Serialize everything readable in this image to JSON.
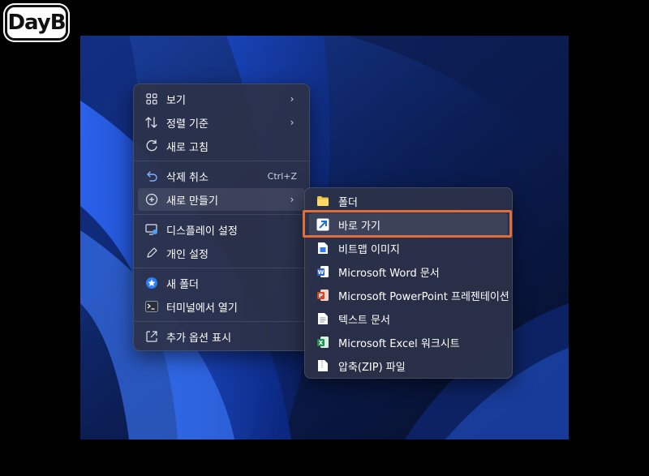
{
  "logo_text": "DayB",
  "context_menu": {
    "items": [
      {
        "label": "보기",
        "icon": "view-grid-icon",
        "submenu": true
      },
      {
        "label": "정렬 기준",
        "icon": "sort-icon",
        "submenu": true
      },
      {
        "label": "새로 고침",
        "icon": "refresh-icon"
      },
      {
        "label": "삭제 취소",
        "icon": "undo-icon",
        "shortcut": "Ctrl+Z"
      },
      {
        "label": "새로 만들기",
        "icon": "new-plus-icon",
        "submenu": true,
        "active": true
      },
      {
        "label": "디스플레이 설정",
        "icon": "display-settings-icon"
      },
      {
        "label": "개인 설정",
        "icon": "pen-icon"
      },
      {
        "label": "새 폴더",
        "icon": "new-folder-icon"
      },
      {
        "label": "터미널에서 열기",
        "icon": "terminal-icon"
      },
      {
        "label": "추가 옵션 표시",
        "icon": "more-options-icon"
      }
    ]
  },
  "new_submenu": {
    "items": [
      {
        "label": "폴더",
        "icon": "folder-icon"
      },
      {
        "label": "바로 가기",
        "icon": "shortcut-icon",
        "highlighted": true
      },
      {
        "label": "비트맵 이미지",
        "icon": "bitmap-file-icon"
      },
      {
        "label": "Microsoft Word 문서",
        "icon": "word-icon"
      },
      {
        "label": "Microsoft PowerPoint 프레젠테이션",
        "icon": "powerpoint-icon"
      },
      {
        "label": "텍스트 문서",
        "icon": "text-file-icon"
      },
      {
        "label": "Microsoft Excel 워크시트",
        "icon": "excel-icon"
      },
      {
        "label": "압축(ZIP) 파일",
        "icon": "zip-file-icon"
      }
    ]
  },
  "colors": {
    "highlight_border": "#e26d3c",
    "menu_background": "#2c3248",
    "word": "#2b5fd9",
    "powerpoint": "#d24726",
    "excel": "#1f8f4e",
    "folder": "#f4c542"
  }
}
